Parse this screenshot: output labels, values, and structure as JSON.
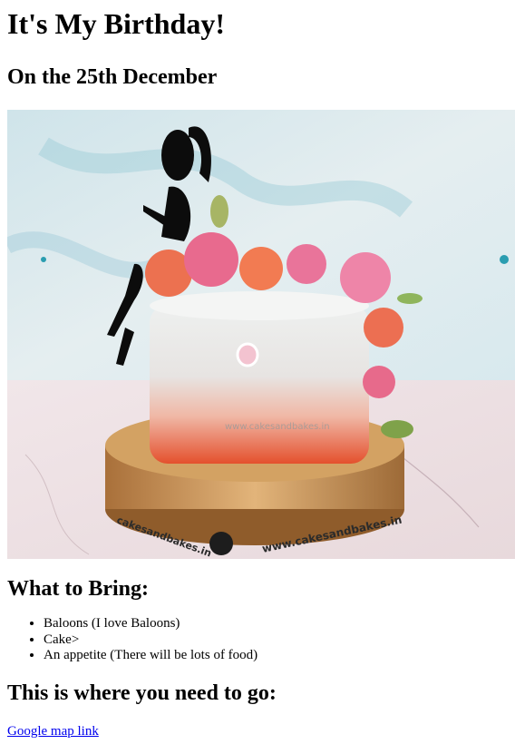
{
  "heading": "It's My Birthday!",
  "date_heading": "On the 25th December",
  "photo": {
    "watermark": "www.cakesandbakes.in",
    "board_text_left": "cakesandbakes.in",
    "board_text_right": "www.cakesandbakes.in",
    "colors": {
      "sky": "#dbe8ec",
      "marble": "#efe3e6",
      "cake": "#e9ecec",
      "board": "#c98f4d",
      "flower": "#e86a8e"
    }
  },
  "bring": {
    "heading": "What to Bring:",
    "items": [
      "Baloons (I love Baloons)",
      "Cake>",
      "An appetite (There will be lots of food)"
    ]
  },
  "directions": {
    "heading": "This is where you need to go:",
    "link_text": "Google map link"
  }
}
